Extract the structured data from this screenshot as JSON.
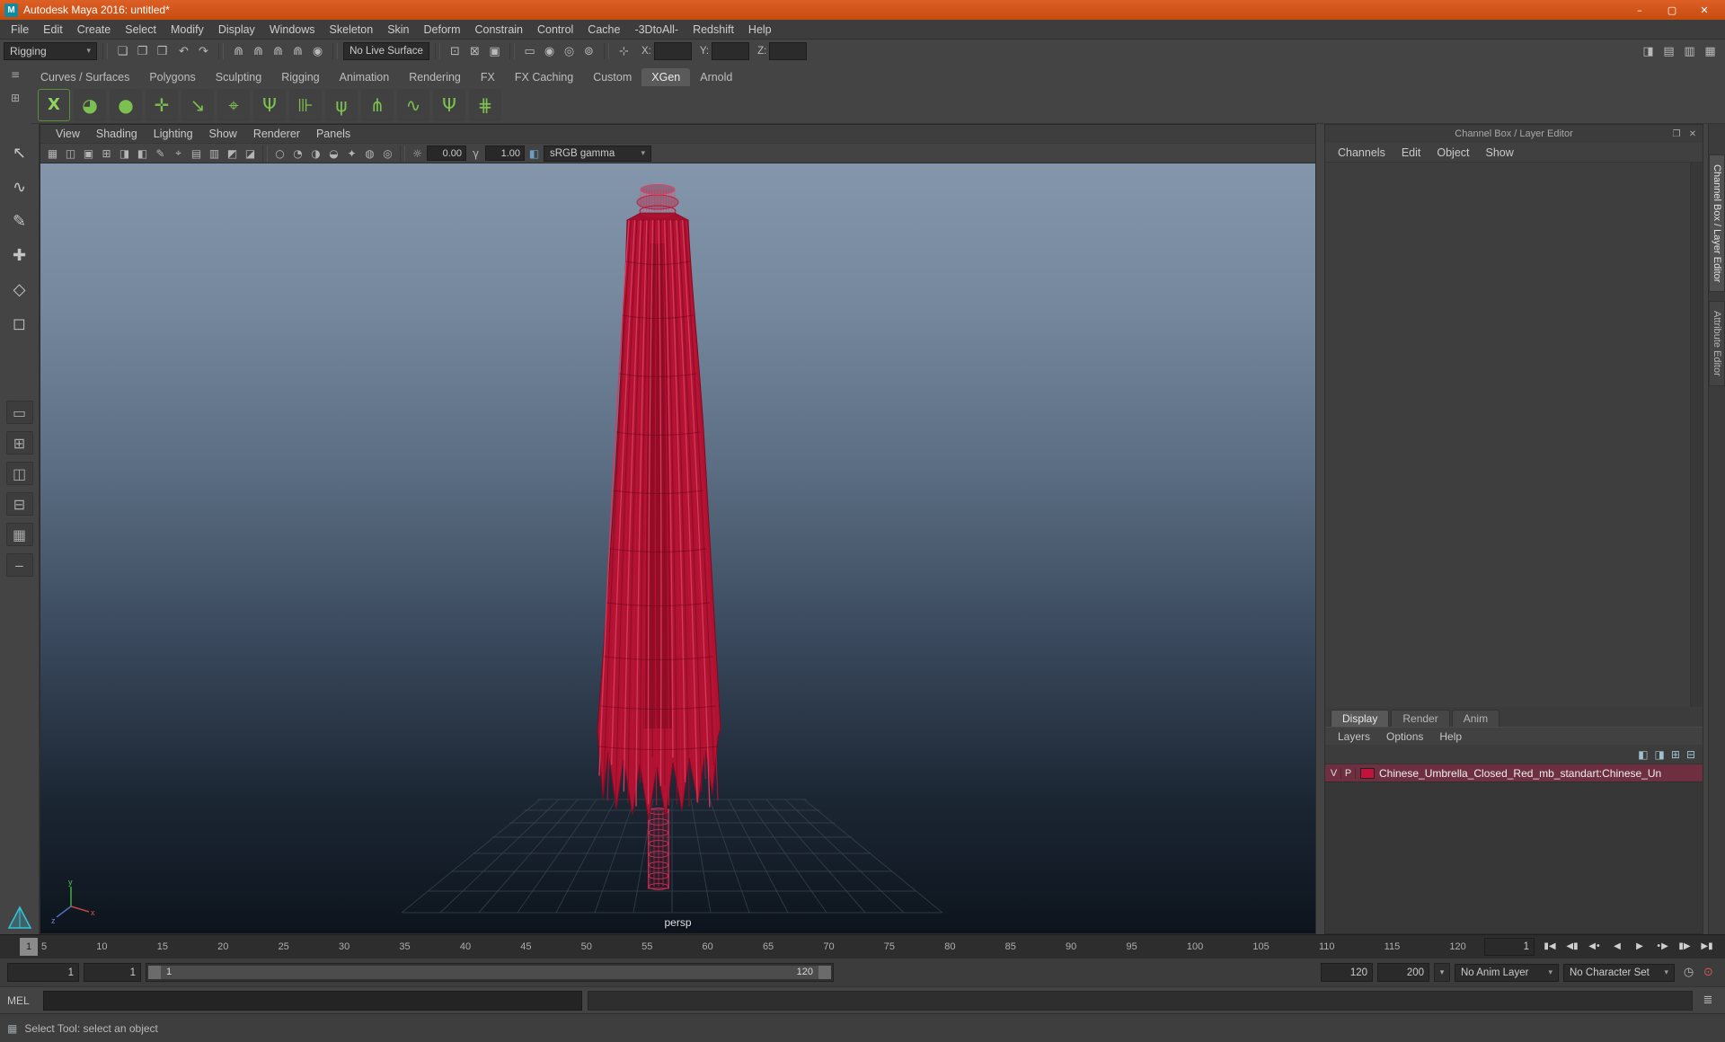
{
  "colors": {
    "accent_orange": "#d4551a",
    "umbrella_red": "#c0143c",
    "layer_row_bg": "#6e3040",
    "shelf_green": "#7cc14f"
  },
  "window": {
    "title": "Autodesk Maya 2016: untitled*",
    "app_icon": "M",
    "minimize": "–",
    "maximize": "▢",
    "close": "✕"
  },
  "menubar": [
    "File",
    "Edit",
    "Create",
    "Select",
    "Modify",
    "Display",
    "Windows",
    "Skeleton",
    "Skin",
    "Deform",
    "Constrain",
    "Control",
    "Cache",
    "-3DtoAll-",
    "Redshift",
    "Help"
  ],
  "statusline": {
    "mode": "Rigging",
    "caret": "▾",
    "file_icons": [
      {
        "name": "new-scene-icon",
        "glyph": "❏"
      },
      {
        "name": "open-scene-icon",
        "glyph": "❐"
      },
      {
        "name": "save-scene-icon",
        "glyph": "❒"
      }
    ],
    "history_icons": [
      {
        "name": "undo-icon",
        "glyph": "↶"
      },
      {
        "name": "redo-icon",
        "glyph": "↷"
      }
    ],
    "snap_icons": [
      {
        "name": "snap-to-grid-icon",
        "glyph": "⋒"
      },
      {
        "name": "snap-to-curve-icon",
        "glyph": "⋒"
      },
      {
        "name": "snap-to-point-icon",
        "glyph": "⋒"
      },
      {
        "name": "snap-to-plane-icon",
        "glyph": "⋒"
      },
      {
        "name": "make-live-icon",
        "glyph": "◉"
      }
    ],
    "live_surface": "No Live Surface",
    "construction_icons": [
      {
        "name": "input-connections-icon",
        "glyph": "⊡"
      },
      {
        "name": "output-connections-icon",
        "glyph": "⊠"
      },
      {
        "name": "construction-history-icon",
        "glyph": "▣"
      }
    ],
    "render_icons": [
      {
        "name": "open-render-view-icon",
        "glyph": "▭"
      },
      {
        "name": "render-current-frame-icon",
        "glyph": "◉"
      },
      {
        "name": "ipr-render-icon",
        "glyph": "◎"
      },
      {
        "name": "render-settings-icon",
        "glyph": "⊚"
      }
    ],
    "coordinate_mode_icon": "⊹",
    "coord_labels": {
      "x": "X:",
      "y": "Y:",
      "z": "Z:"
    },
    "sidebar_icons": [
      {
        "name": "toggle-modeling-toolkit-icon",
        "glyph": "◨"
      },
      {
        "name": "toggle-attribute-editor-icon",
        "glyph": "▤"
      },
      {
        "name": "toggle-tool-settings-icon",
        "glyph": "▥"
      },
      {
        "name": "toggle-channel-box-icon",
        "glyph": "▦"
      }
    ]
  },
  "shelf": {
    "menu_icon": "≡",
    "gear_icon": "⊞",
    "tabs": [
      {
        "label": "Curves / Surfaces"
      },
      {
        "label": "Polygons"
      },
      {
        "label": "Sculpting"
      },
      {
        "label": "Rigging"
      },
      {
        "label": "Animation"
      },
      {
        "label": "Rendering"
      },
      {
        "label": "FX"
      },
      {
        "label": "FX Caching"
      },
      {
        "label": "Custom"
      },
      {
        "label": "XGen",
        "active": true
      },
      {
        "label": "Arnold"
      }
    ],
    "icons": [
      {
        "name": "xgen-editor-icon",
        "glyph": "X",
        "cls": "xgen"
      },
      {
        "name": "xgen-sphere-icon",
        "glyph": "◕"
      },
      {
        "name": "xgen-geometry-icon",
        "glyph": "●"
      },
      {
        "name": "xgen-add-collection-icon",
        "glyph": "✛"
      },
      {
        "name": "xgen-export-selection-icon",
        "glyph": "↘"
      },
      {
        "name": "xgen-create-guide-icon",
        "glyph": "⌖"
      },
      {
        "name": "xgen-place-guides-icon",
        "glyph": "Ψ"
      },
      {
        "name": "xgen-lock-guides-icon",
        "glyph": "⊪"
      },
      {
        "name": "xgen-grass-preset-icon",
        "glyph": "ψ"
      },
      {
        "name": "xgen-clumping-icon",
        "glyph": "⋔"
      },
      {
        "name": "xgen-curves-icon",
        "glyph": "∿"
      },
      {
        "name": "xgen-density-icon",
        "glyph": "Ψ"
      },
      {
        "name": "xgen-comb-icon",
        "glyph": "⋕"
      }
    ]
  },
  "toolbox": {
    "tools": [
      {
        "name": "select-tool",
        "glyph": "↖"
      },
      {
        "name": "lasso-tool",
        "glyph": "∿"
      },
      {
        "name": "paint-select-tool",
        "glyph": "✎"
      },
      {
        "name": "move-tool",
        "glyph": "✚"
      },
      {
        "name": "rotate-tool",
        "glyph": "◇"
      },
      {
        "name": "scale-tool",
        "glyph": "◻"
      }
    ],
    "layouts": [
      {
        "name": "layout-single-pane-button",
        "glyph": "▭"
      },
      {
        "name": "layout-four-view-button",
        "glyph": "⊞"
      },
      {
        "name": "layout-two-pane-side-button",
        "glyph": "◫"
      },
      {
        "name": "layout-two-pane-stacked-button",
        "glyph": "⊟"
      },
      {
        "name": "layout-preset-button",
        "glyph": "▦"
      },
      {
        "name": "toolbox-collapse-button",
        "glyph": "‒"
      }
    ]
  },
  "viewport": {
    "menu": [
      "View",
      "Shading",
      "Lighting",
      "Show",
      "Renderer",
      "Panels"
    ],
    "toolbar_icons_a": [
      {
        "name": "select-camera-icon",
        "glyph": "▦"
      },
      {
        "name": "lock-camera-icon",
        "glyph": "◫"
      },
      {
        "name": "camera-attributes-icon",
        "glyph": "▣"
      },
      {
        "name": "bookmark-icon",
        "glyph": "⊞"
      },
      {
        "name": "image-plane-icon",
        "glyph": "◨"
      },
      {
        "name": "2d-pan-zoom-icon",
        "glyph": "◧"
      },
      {
        "name": "grease-pencil-icon",
        "glyph": "✎"
      },
      {
        "name": "snapshot-icon",
        "glyph": "⌖"
      },
      {
        "name": "isolate-select-icon",
        "glyph": "▤"
      },
      {
        "name": "field-chart-icon",
        "glyph": "▥"
      },
      {
        "name": "safe-action-icon",
        "glyph": "◩"
      },
      {
        "name": "safe-title-icon",
        "glyph": "◪"
      }
    ],
    "toolbar_icons_b": [
      {
        "name": "wireframe-mode-icon",
        "glyph": "○"
      },
      {
        "name": "shaded-mode-icon",
        "glyph": "◔"
      },
      {
        "name": "textured-mode-icon",
        "glyph": "◑"
      },
      {
        "name": "lighting-toggle-icon",
        "glyph": "◒"
      },
      {
        "name": "shadows-toggle-icon",
        "glyph": "✦"
      },
      {
        "name": "ao-toggle-icon",
        "glyph": "◍"
      },
      {
        "name": "motion-blur-toggle-icon",
        "glyph": "◎"
      }
    ],
    "exposure_icon": "☼",
    "exposure": "0.00",
    "gamma_icon": "γ",
    "gamma": "1.00",
    "view_transform_icon": "◧",
    "gamma_label": "sRGB gamma",
    "gamma_caret": "▾",
    "camera_label": "persp",
    "axis": {
      "x": "x",
      "y": "y",
      "z": "z"
    }
  },
  "channelbox": {
    "header": "Channel Box / Layer Editor",
    "header_icons": [
      {
        "name": "float-panel-icon",
        "glyph": "❐"
      },
      {
        "name": "close-panel-icon",
        "glyph": "✕"
      }
    ],
    "menus": [
      "Channels",
      "Edit",
      "Object",
      "Show"
    ],
    "layer_tabs": [
      {
        "label": "Display",
        "active": true
      },
      {
        "label": "Render"
      },
      {
        "label": "Anim"
      }
    ],
    "layer_menus": [
      "Layers",
      "Options",
      "Help"
    ],
    "layer_icons": [
      {
        "name": "layer-move-up-icon",
        "glyph": "◧"
      },
      {
        "name": "layer-move-down-icon",
        "glyph": "◨"
      },
      {
        "name": "create-empty-layer-icon",
        "glyph": "⊞"
      },
      {
        "name": "create-layer-from-selected-icon",
        "glyph": "⊟"
      }
    ],
    "layer_row": {
      "visibility": "V",
      "playback": "P",
      "swatch_color": "#c0143c",
      "label": "Chinese_Umbrella_Closed_Red_mb_standart:Chinese_Un"
    }
  },
  "right_tabs": [
    {
      "label": "Channel Box / Layer Editor",
      "active": true
    },
    {
      "label": "Attribute Editor"
    }
  ],
  "timeslider": {
    "current_marker": "1",
    "ticks": [
      5,
      10,
      15,
      20,
      25,
      30,
      35,
      40,
      45,
      50,
      55,
      60,
      65,
      70,
      75,
      80,
      85,
      90,
      95,
      100,
      105,
      110,
      115,
      120
    ],
    "current_field": "1",
    "playback": [
      {
        "name": "go-to-start-button",
        "glyph": "▮◀"
      },
      {
        "name": "step-back-frame-button",
        "glyph": "◀▮"
      },
      {
        "name": "step-back-key-button",
        "glyph": "◀•"
      },
      {
        "name": "play-backwards-button",
        "glyph": "◀"
      },
      {
        "name": "play-forwards-button",
        "glyph": "▶"
      },
      {
        "name": "step-forward-key-button",
        "glyph": "•▶"
      },
      {
        "name": "step-forward-frame-button",
        "glyph": "▮▶"
      },
      {
        "name": "go-to-end-button",
        "glyph": "▶▮"
      }
    ]
  },
  "rangeslider": {
    "anim_start": "1",
    "playback_start": "1",
    "handle_start": "1",
    "handle_end": "120",
    "playback_end": "120",
    "anim_end": "200",
    "caret": "▾",
    "anim_layer": "No Anim Layer",
    "character_set": "No Character Set",
    "icons": [
      {
        "name": "playback-speed-icon",
        "glyph": "◷"
      },
      {
        "name": "auto-keyframe-icon",
        "glyph": "⊙",
        "color": "#cf5b5b"
      }
    ]
  },
  "commandline": {
    "label": "MEL",
    "input": "",
    "script_editor_icon": "≣"
  },
  "helpline": {
    "icon": "▦",
    "text": "Select Tool: select an object"
  }
}
